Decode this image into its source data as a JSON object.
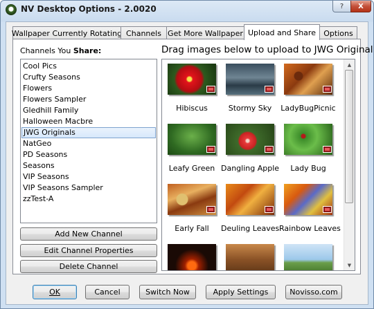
{
  "window": {
    "title": "NV Desktop Options - 2.0020",
    "help_button": "?",
    "close_button": "X"
  },
  "tabs": [
    {
      "label": "Wallpaper Currently Rotating"
    },
    {
      "label": "Channels"
    },
    {
      "label": "Get More Wallpaper"
    },
    {
      "label": "Upload and Share"
    },
    {
      "label": "Options"
    }
  ],
  "share": {
    "label_prefix": "Channels You ",
    "label_bold": "Share:",
    "channels": [
      "Cool Pics",
      "Crufty Seasons",
      "Flowers",
      "Flowers Sampler",
      "Gledhill Family",
      "Halloween Macbre",
      "JWG Originals",
      "NatGeo",
      "PD Seasons",
      "Seasons",
      "VIP Seasons",
      "VIP Seasons Sampler",
      "zzTest-A"
    ],
    "selected_channel": "JWG Originals",
    "add_button": "Add New Channel",
    "edit_button": "Edit Channel Properties",
    "delete_button": "Delete Channel"
  },
  "upload": {
    "label": "Drag images below to upload to JWG Originals",
    "images": [
      {
        "caption": "Hibiscus"
      },
      {
        "caption": "Stormy Sky"
      },
      {
        "caption": "LadyBugPicnic"
      },
      {
        "caption": "Leafy Green"
      },
      {
        "caption": "Dangling Apple"
      },
      {
        "caption": "Lady Bug"
      },
      {
        "caption": "Early Fall"
      },
      {
        "caption": "Deuling Leaves"
      },
      {
        "caption": "Rainbow Leaves"
      },
      {
        "caption": ""
      },
      {
        "caption": ""
      },
      {
        "caption": ""
      }
    ]
  },
  "footer": {
    "ok": "OK",
    "cancel": "Cancel",
    "switch_now": "Switch Now",
    "apply_settings": "Apply Settings",
    "novisso": "Novisso.com"
  }
}
